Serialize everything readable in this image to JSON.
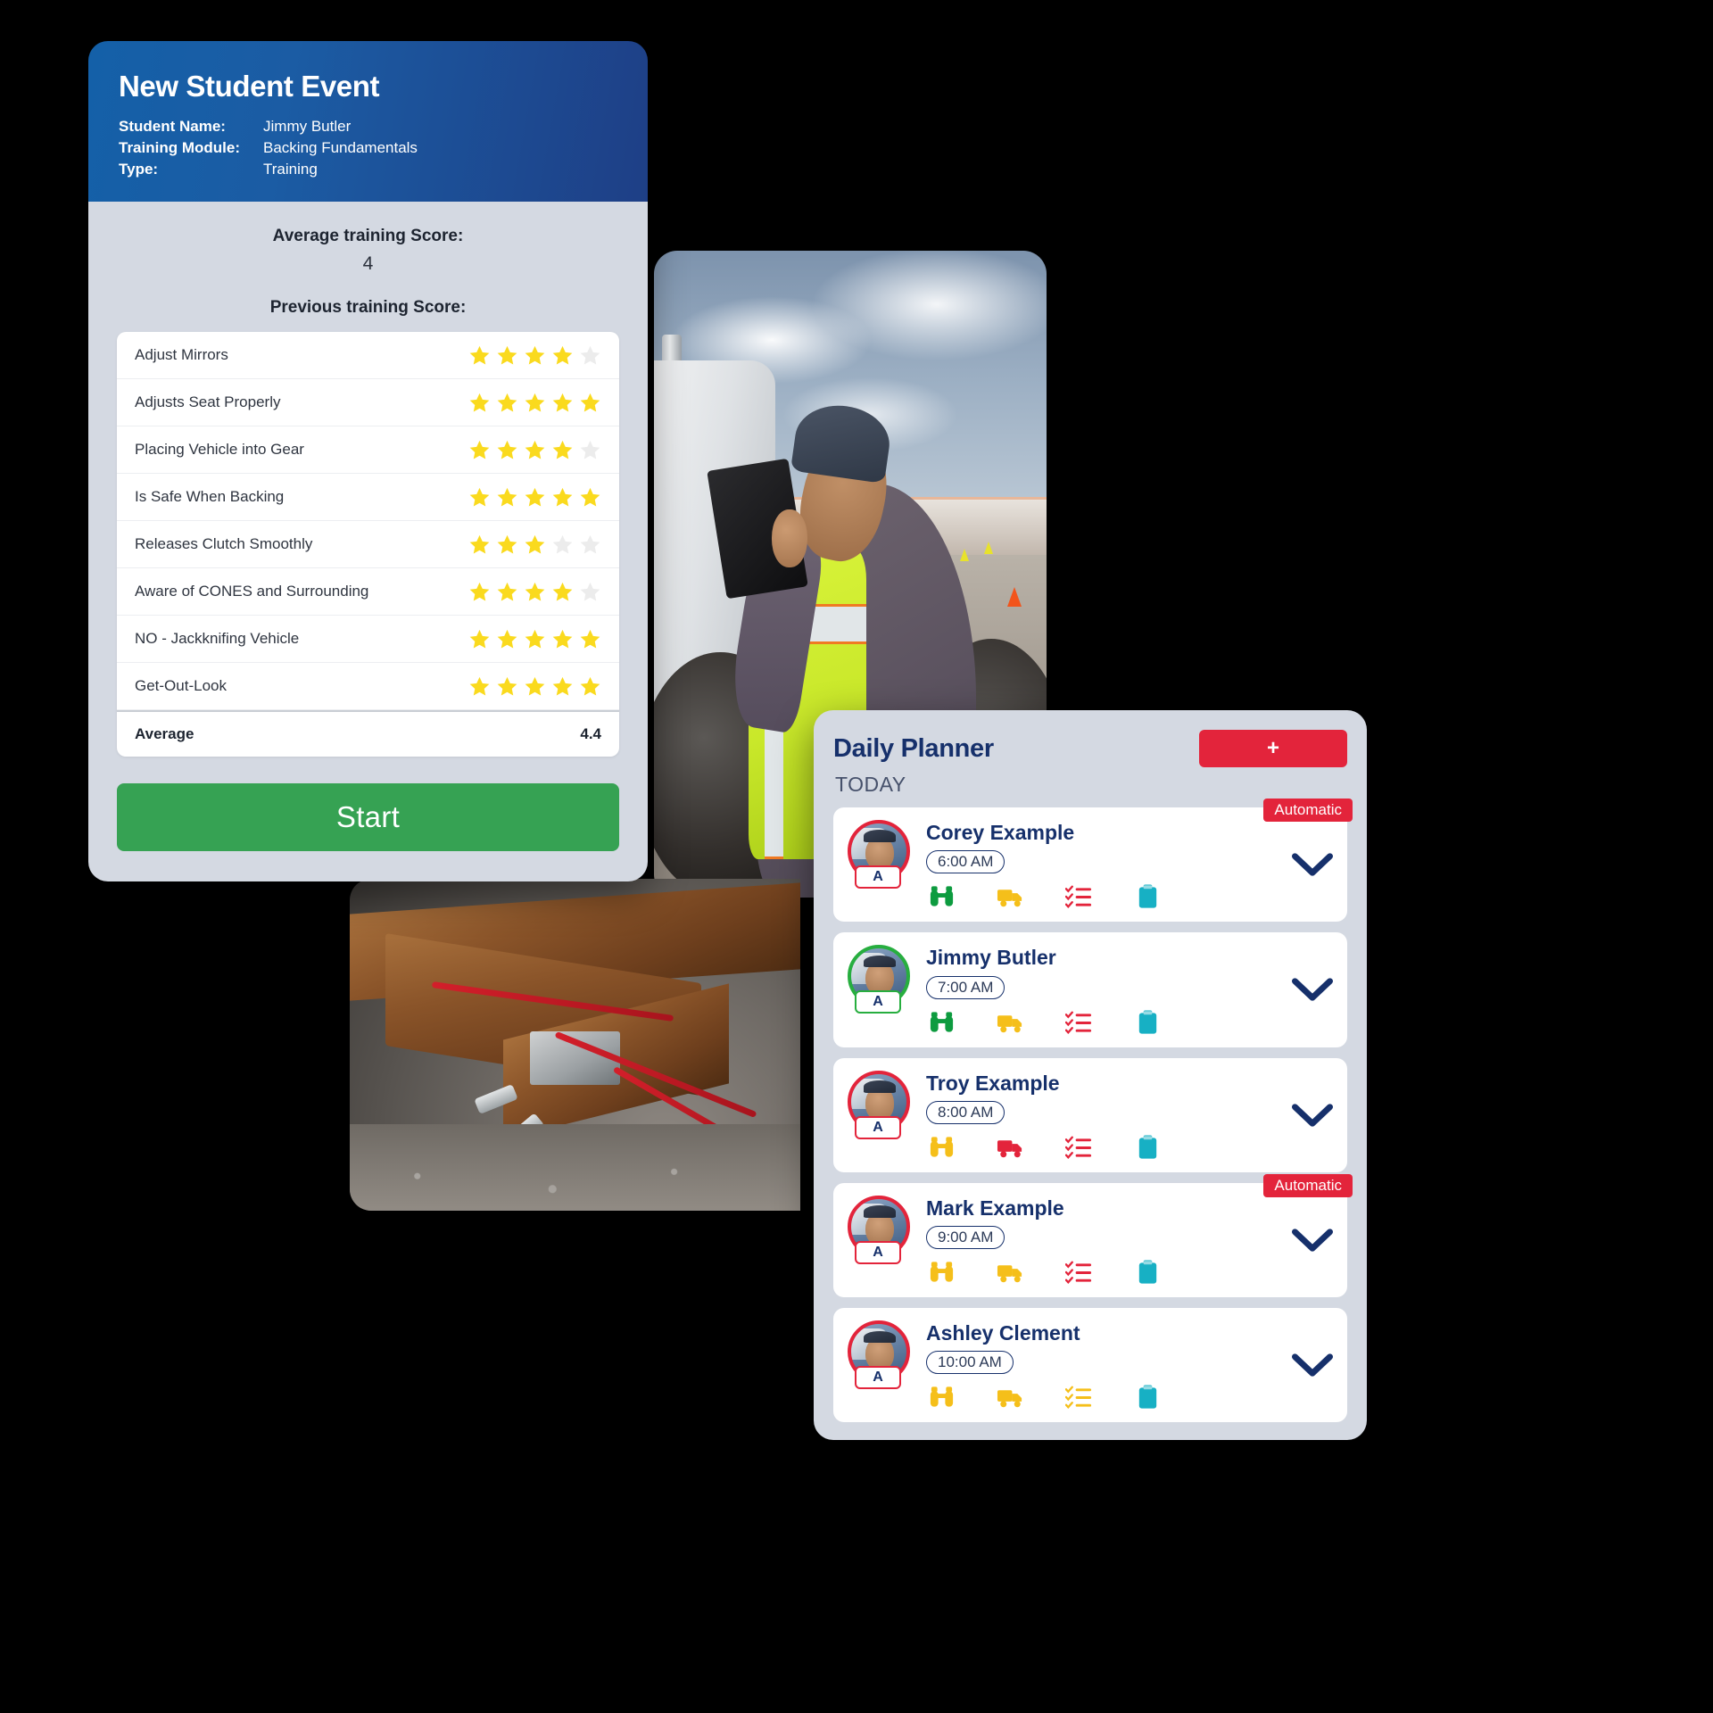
{
  "training_card": {
    "title": "New Student Event",
    "meta": [
      {
        "label": "Student Name:",
        "value": "Jimmy Butler"
      },
      {
        "label": "Training Module:",
        "value": "Backing Fundamentals"
      },
      {
        "label": "Type:",
        "value": "Training"
      }
    ],
    "average_score_label": "Average training Score:",
    "average_score_value": "4",
    "previous_score_label": "Previous training Score:",
    "max_stars": 5,
    "rows": [
      {
        "label": "Adjust Mirrors",
        "stars": 4
      },
      {
        "label": "Adjusts Seat Properly",
        "stars": 5
      },
      {
        "label": "Placing Vehicle into Gear",
        "stars": 4
      },
      {
        "label": "Is Safe When Backing",
        "stars": 5
      },
      {
        "label": "Releases Clutch Smoothly",
        "stars": 3
      },
      {
        "label": "Aware of CONES and Surrounding",
        "stars": 4
      },
      {
        "label": "NO - Jackknifing Vehicle",
        "stars": 5
      },
      {
        "label": "Get-Out-Look",
        "stars": 5
      }
    ],
    "average_row_label": "Average",
    "average_row_value": "4.4",
    "start_button_label": "Start",
    "colors": {
      "header_gradient_start": "#1460a8",
      "header_gradient_end": "#1e3f86",
      "body_bg": "#d4d9e2",
      "star_filled": "#fada1e",
      "star_empty": "#ececec",
      "start_button": "#36a253"
    }
  },
  "daily_planner": {
    "title": "Daily Planner",
    "add_button_label": "+",
    "section_label": "TODAY",
    "colors": {
      "accent_red": "#e3243b",
      "accent_green": "#27ae3f",
      "title_blue": "#16306b",
      "panel_bg": "#d4d9e2"
    },
    "icon_names": [
      "binoculars-icon",
      "truck-icon",
      "checklist-icon",
      "clipboard-icon"
    ],
    "entries": [
      {
        "name": "Corey Example",
        "time": "6:00 AM",
        "badge_letter": "A",
        "ring_color": "#e3243b",
        "automatic_label": "Automatic",
        "has_automatic": true,
        "icon_colors": [
          "#0d9b3f",
          "#f5bf1a",
          "#e3243b",
          "#17b0c4"
        ],
        "avatar_kind": "bearded-driver"
      },
      {
        "name": "Jimmy Butler",
        "time": "7:00 AM",
        "badge_letter": "A",
        "ring_color": "#27ae3f",
        "automatic_label": "",
        "has_automatic": false,
        "icon_colors": [
          "#0d9b3f",
          "#f5bf1a",
          "#e3243b",
          "#17b0c4"
        ],
        "avatar_kind": "capped-driver"
      },
      {
        "name": "Troy Example",
        "time": "8:00 AM",
        "badge_letter": "A",
        "ring_color": "#e3243b",
        "automatic_label": "",
        "has_automatic": false,
        "icon_colors": [
          "#f5bf1a",
          "#e3243b",
          "#e3243b",
          "#17b0c4"
        ],
        "avatar_kind": "young-driver"
      },
      {
        "name": "Mark Example",
        "time": "9:00 AM",
        "badge_letter": "A",
        "ring_color": "#e3243b",
        "automatic_label": "Automatic",
        "has_automatic": true,
        "icon_colors": [
          "#f5bf1a",
          "#f5bf1a",
          "#e3243b",
          "#17b0c4"
        ],
        "avatar_kind": "cab-driver"
      },
      {
        "name": "Ashley Clement",
        "time": "10:00 AM",
        "badge_letter": "A",
        "ring_color": "#e3243b",
        "automatic_label": "",
        "has_automatic": false,
        "icon_colors": [
          "#f5bf1a",
          "#f5bf1a",
          "#f5bf1a",
          "#17b0c4"
        ],
        "avatar_kind": "blue-truck"
      }
    ]
  },
  "photos": [
    {
      "name": "truck-inspection-photo",
      "description": "Instructor in safety vest holding tablet beside semi truck with traffic cones"
    },
    {
      "name": "trailer-frame-photo",
      "description": "Close-up of rusty trailer frame with red air lines and metal fitting"
    }
  ]
}
